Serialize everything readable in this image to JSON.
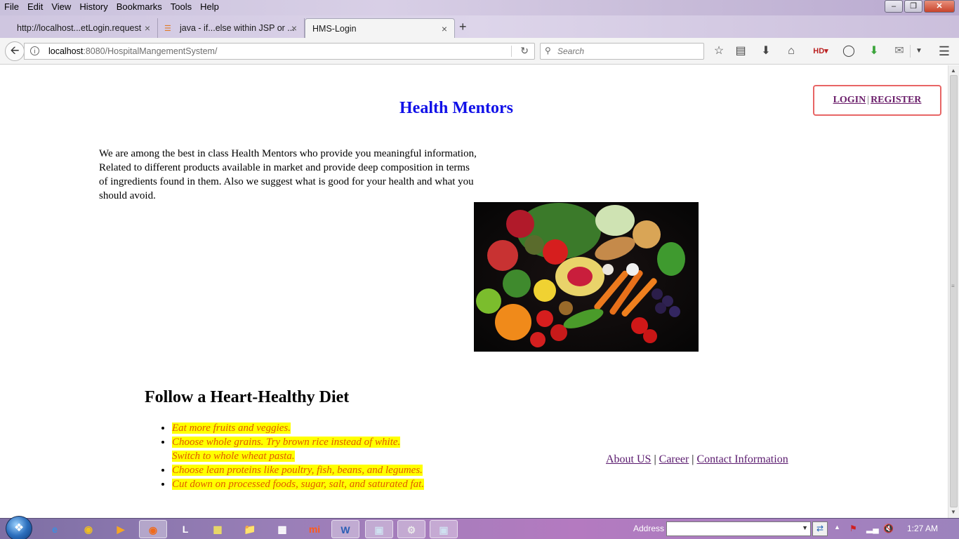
{
  "menu": [
    "File",
    "Edit",
    "View",
    "History",
    "Bookmarks",
    "Tools",
    "Help"
  ],
  "tabs": [
    {
      "label": "http://localhost...etLogin.request",
      "active": false
    },
    {
      "label": "java - if...else within JSP or ...",
      "active": false
    },
    {
      "label": "HMS-Login",
      "active": true
    }
  ],
  "url": {
    "host": "localhost",
    "rest": ":8080/HospitalMangementSystem/"
  },
  "search": {
    "placeholder": "Search"
  },
  "page": {
    "title": "Health Mentors",
    "auth": {
      "login": "LOGIN",
      "separator": "|",
      "register": "REGISTER"
    },
    "intro": "We are among the best in class Health Mentors who provide you meaningful information, Related to different products available in market and provide deep composition in terms of ingredients found in them. Also we suggest what is good for your health and what you should avoid.",
    "diet_heading": "Follow a Heart-Healthy Diet",
    "diet_items": [
      "Eat more fruits and veggies.",
      "Choose whole grains. Try brown rice instead of white.",
      "Switch to whole wheat pasta.",
      "Choose lean proteins like poultry, fish, beans, and legumes.",
      "Cut down on processed foods, sugar, salt, and saturated fat."
    ],
    "footer": {
      "about": "About US",
      "sep1": "|",
      "career": "Career",
      "sep2": "|",
      "contact": "Contact Information"
    }
  },
  "taskbar": {
    "address_label": "Address",
    "clock": "1:27 AM"
  },
  "colors": {
    "title_blue": "#1010e8",
    "highlight": "#ffff00",
    "list_text": "#e05a00",
    "auth_border": "#e86565",
    "link": "#5a1a6e"
  }
}
